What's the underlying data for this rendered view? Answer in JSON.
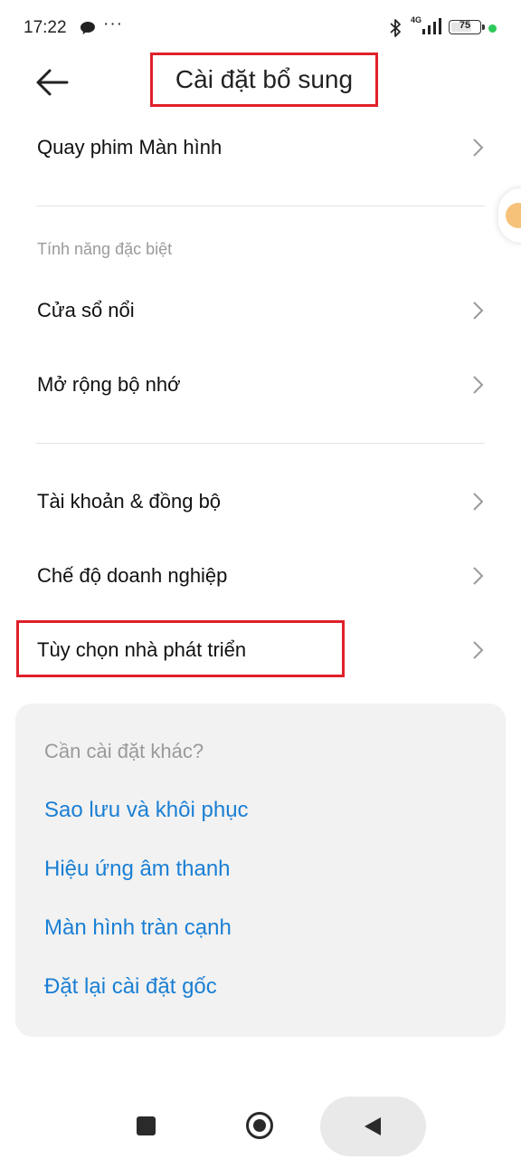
{
  "status_bar": {
    "time": "17:22",
    "more": "···",
    "network": "4G",
    "battery": "75",
    "battery_level": 0.75
  },
  "header": {
    "title": "Cài đặt bổ sung"
  },
  "items": {
    "screen_recording": "Quay phim Màn hình",
    "section_special": "Tính năng đặc biệt",
    "floating_window": "Cửa sổ nổi",
    "memory_expansion": "Mở rộng bộ nhớ",
    "accounts_sync": "Tài khoản & đồng bộ",
    "enterprise_mode": "Chế độ doanh nghiệp",
    "developer_options": "Tùy chọn nhà phát triển"
  },
  "suggestions": {
    "title": "Cần cài đặt khác?",
    "links": [
      "Sao lưu và khôi phục",
      "Hiệu ứng âm thanh",
      "Màn hình tràn cạnh",
      "Đặt lại cài đặt gốc"
    ]
  },
  "colors": {
    "highlight": "#e0202a",
    "link": "#1a7fd4",
    "status_dot": "#2ec85a"
  }
}
